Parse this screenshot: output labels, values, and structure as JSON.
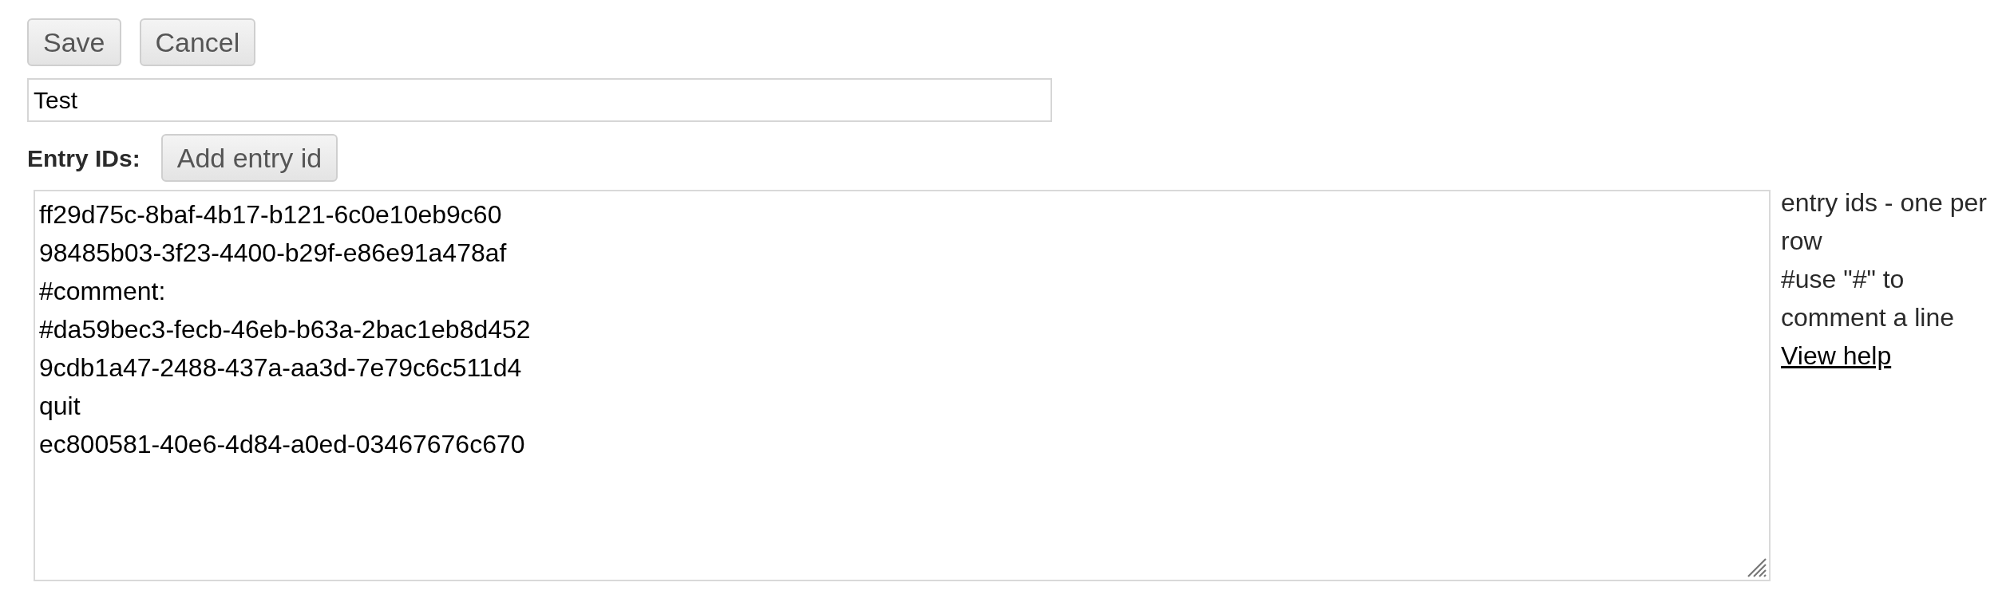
{
  "toolbar": {
    "buttons": [
      "Save",
      "Cancel"
    ]
  },
  "name_field": {
    "value": "Test"
  },
  "entry_ids": {
    "label": "Entry IDs:",
    "add_button": "Add entry id",
    "lines": [
      "ff29d75c-8baf-4b17-b121-6c0e10eb9c60",
      "98485b03-3f23-4400-b29f-e86e91a478af",
      "#comment:",
      "#da59bec3-fecb-46eb-b63a-2bac1eb8d452",
      "9cdb1a47-2488-437a-aa3d-7e79c6c511d4",
      "quit",
      "ec800581-40e6-4d84-a0ed-03467676c670"
    ]
  },
  "help": {
    "lines": [
      "entry ids - one per row",
      "#use \"#\" to comment a line"
    ],
    "link": "View help"
  }
}
